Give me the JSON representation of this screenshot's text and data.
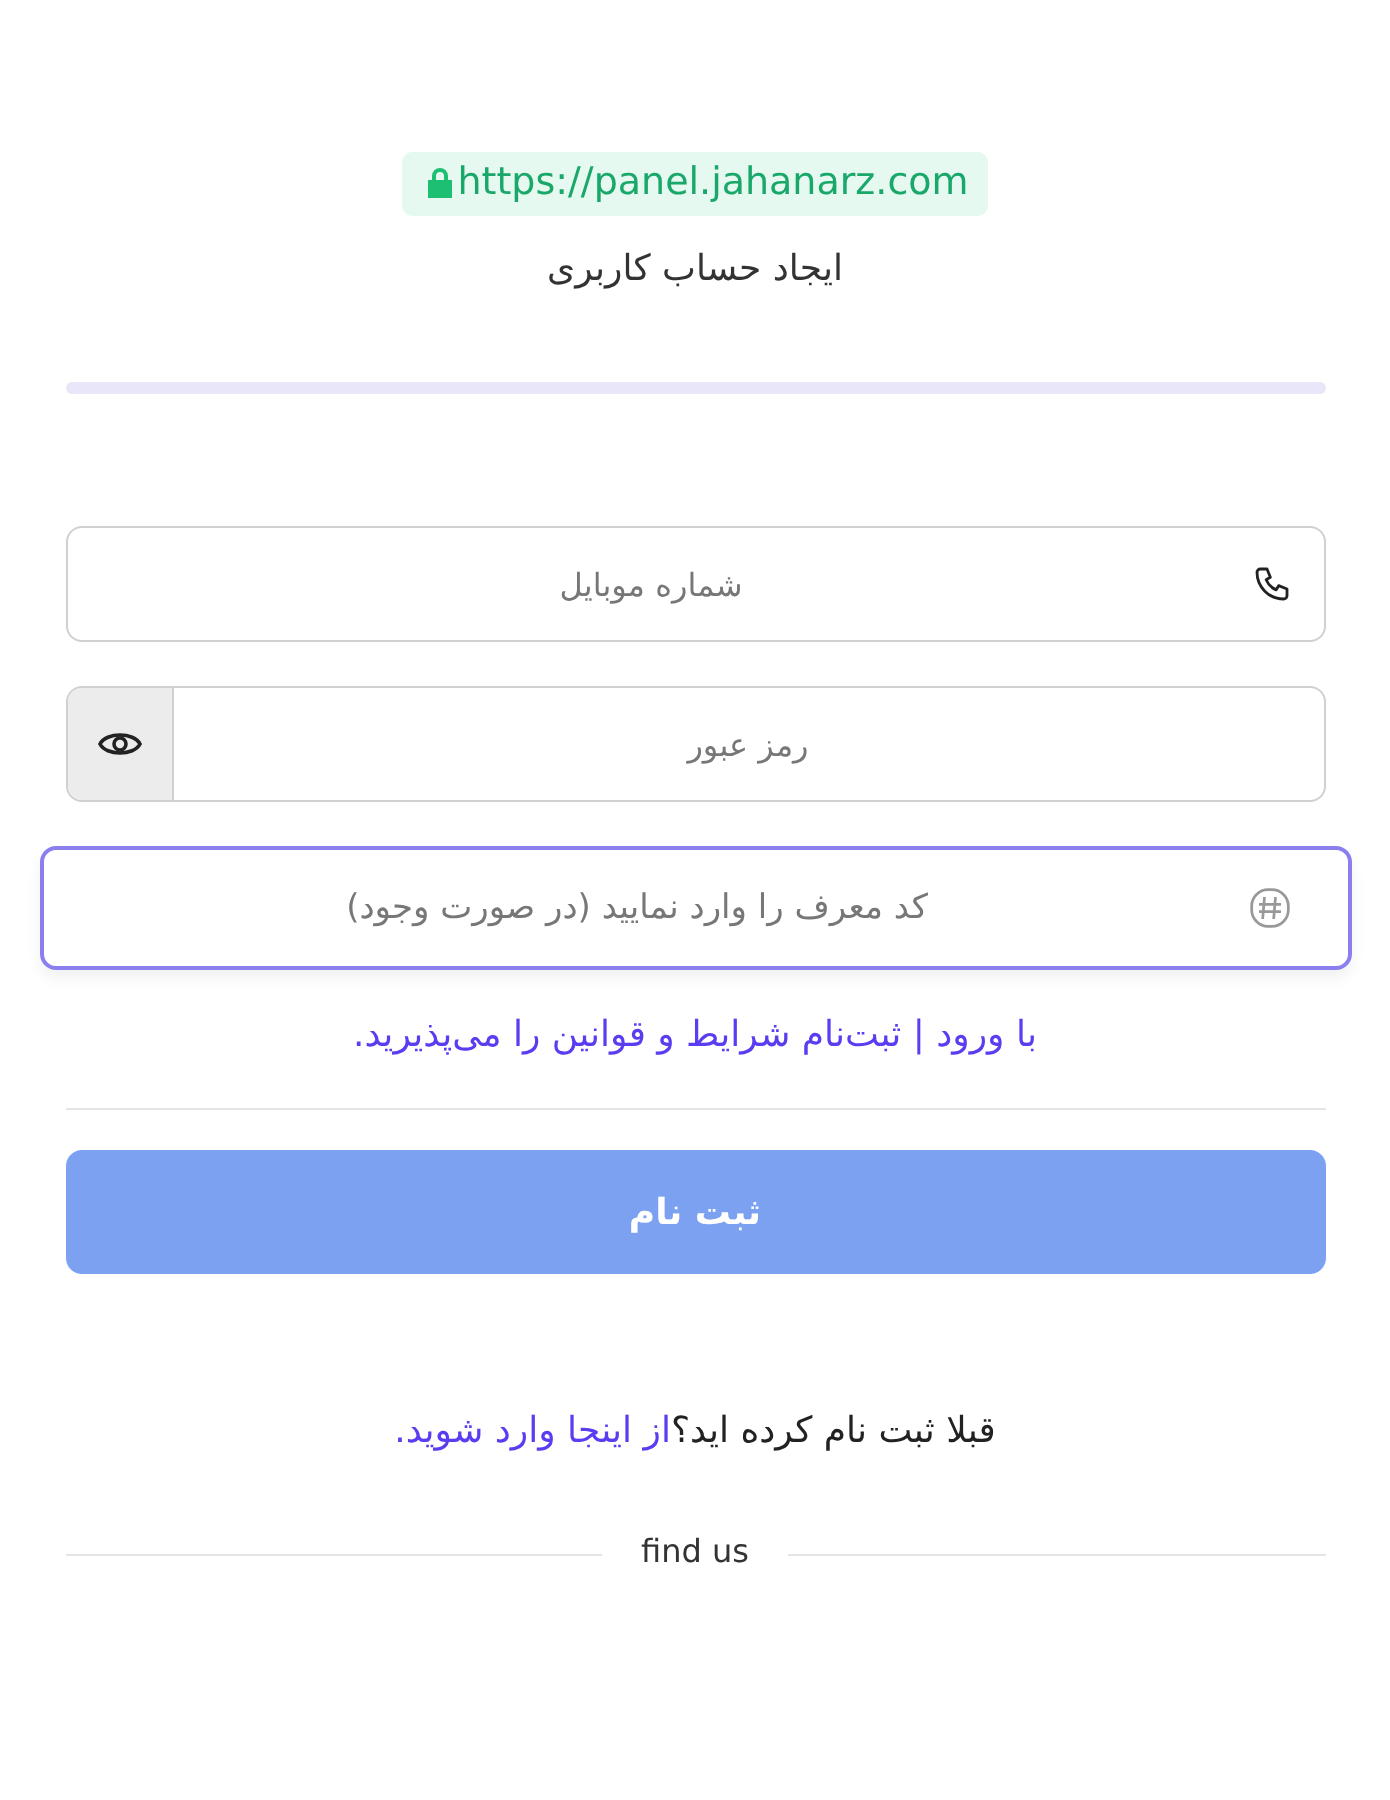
{
  "address_bar": {
    "url": "https://panel.jahanarz.com"
  },
  "title": "ایجاد حساب کاربری",
  "fields": [
    {
      "kind": "phone",
      "placeholder": "شماره موبایل",
      "focused": false
    },
    {
      "kind": "password",
      "placeholder": "رمز عبور",
      "focused": false
    },
    {
      "kind": "referral",
      "placeholder": "کد معرف را وارد نمایید (در صورت وجود)",
      "focused": true
    }
  ],
  "terms_link": "با ورود | ثبت‌نام شرایط و قوانین را می‌پذیرید.",
  "submit_button": {
    "label": "ثبت نام",
    "disabled": true
  },
  "login_prompt": {
    "text": "قبلا ثبت نام کرده اید؟",
    "link": "از اینجا وارد شوید."
  },
  "find_us": "find us"
}
